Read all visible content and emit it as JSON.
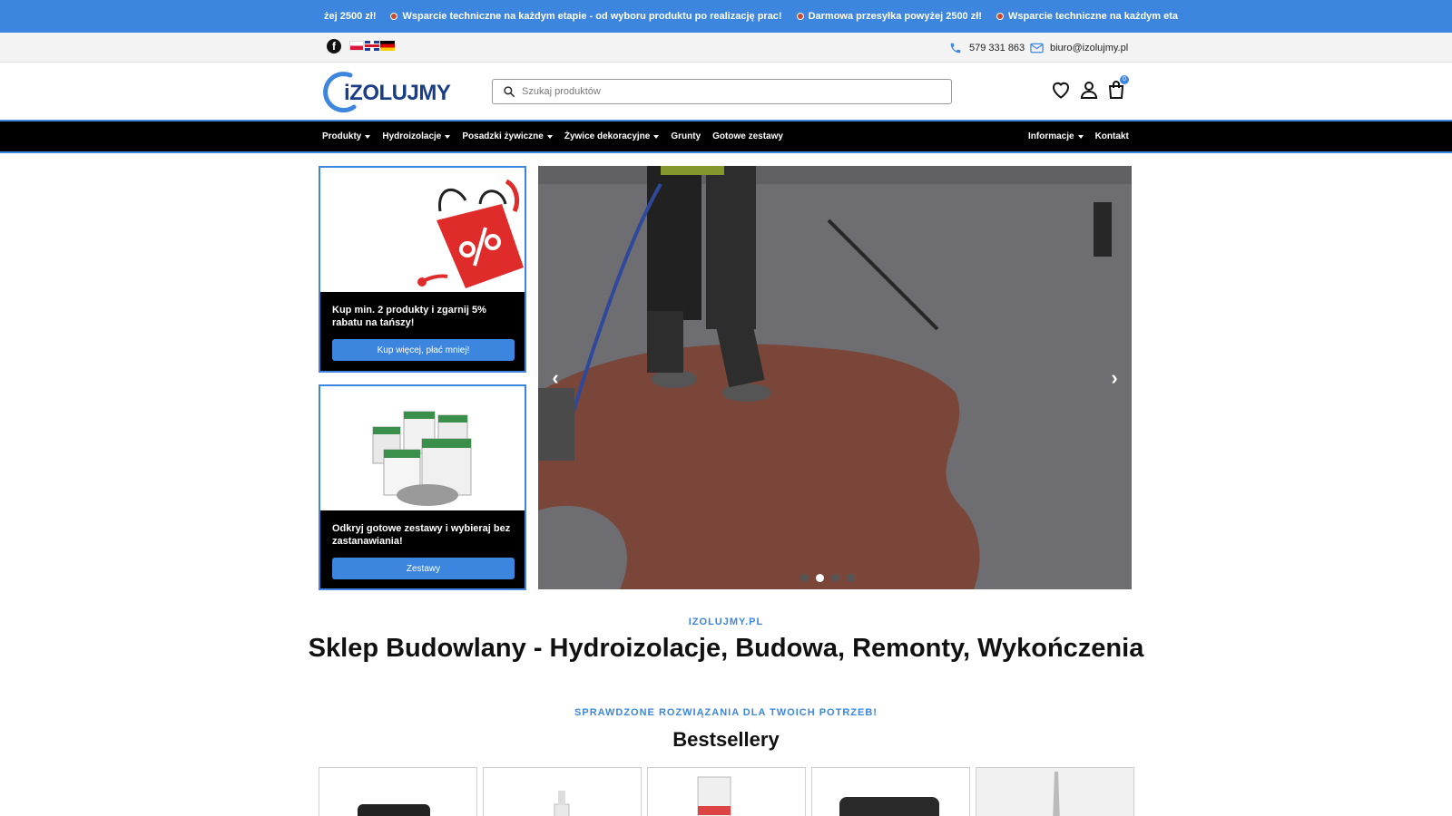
{
  "ticker": {
    "items": [
      {
        "text": "żej 2500 zł!",
        "icon": "none"
      },
      {
        "text": "Wsparcie techniczne na każdym etapie - od wyboru produktu po realizację prac!",
        "icon": "bullet-icon"
      },
      {
        "text": "Darmowa przesyłka powyżej 2500 zł!",
        "icon": "bullet-icon"
      },
      {
        "text": "Wsparcie techniczne na każdym eta",
        "icon": "bullet-icon"
      }
    ]
  },
  "utility": {
    "social_icon": "facebook-icon",
    "languages": [
      "PL",
      "EN",
      "DE"
    ],
    "phone": "579 331 863",
    "email": "biuro@izolujmy.pl"
  },
  "header": {
    "logo_text": "iZOLUJMY",
    "search_placeholder": "Szukaj produktów",
    "cart_count": "0",
    "icons": [
      "heart-icon",
      "user-icon",
      "shopping-bag-icon"
    ]
  },
  "nav": {
    "left": [
      {
        "label": "Produkty",
        "dropdown": true
      },
      {
        "label": "Hydroizolacje",
        "dropdown": true
      },
      {
        "label": "Posadzki żywiczne",
        "dropdown": true
      },
      {
        "label": "Żywice dekoracyjne",
        "dropdown": true
      },
      {
        "label": "Grunty",
        "dropdown": false
      },
      {
        "label": "Gotowe zestawy",
        "dropdown": false
      }
    ],
    "right": [
      {
        "label": "Informacje",
        "dropdown": true
      },
      {
        "label": "Kontakt",
        "dropdown": false
      }
    ]
  },
  "promos": [
    {
      "text": "Kup min. 2 produkty i zgarnij 5% rabatu na tańszy!",
      "button": "Kup więcej, płać mniej!",
      "image": "discount-bag-illustration"
    },
    {
      "text": "Odkryj gotowe zestawy i wybieraj bez zastanawiania!",
      "button": "Zestawy",
      "image": "product-buckets-photo"
    }
  ],
  "slider": {
    "slides_count": 4,
    "active_index": 1,
    "image": "worker-spraying-roof-coating-photo"
  },
  "section1": {
    "kicker": "IZOLUJMY.PL",
    "title": "Sklep Budowlany - Hydroizolacje, Budowa, Remonty, Wykończenia"
  },
  "section2": {
    "kicker": "SPRAWDZONE ROZWIĄZANIA DLA TWOICH POTRZEB!",
    "title": "Bestsellery"
  },
  "colors": {
    "accent": "#3d86df",
    "nav_bg": "#000000",
    "logo": "#1a3e86"
  }
}
